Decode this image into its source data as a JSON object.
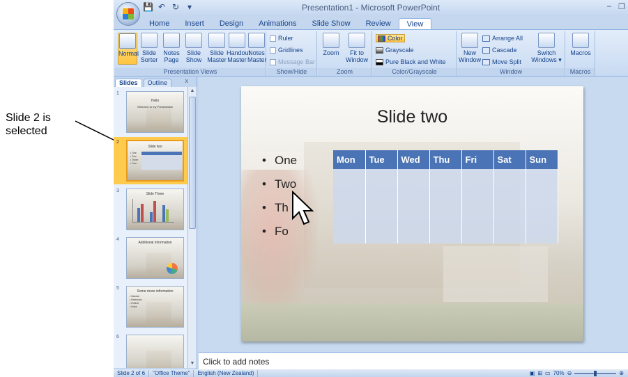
{
  "annotation": {
    "line1": "Slide 2 is",
    "line2": "selected"
  },
  "window": {
    "title": "Presentation1 - Microsoft PowerPoint",
    "minimize": "–",
    "restore": "❐"
  },
  "qat": {
    "save": "💾",
    "undo": "↶",
    "redo": "↻",
    "more": "▾"
  },
  "tabs": [
    {
      "label": "Home"
    },
    {
      "label": "Insert"
    },
    {
      "label": "Design"
    },
    {
      "label": "Animations"
    },
    {
      "label": "Slide Show"
    },
    {
      "label": "Review"
    },
    {
      "label": "View"
    }
  ],
  "ribbon": {
    "presentation_views": {
      "label": "Presentation Views",
      "normal": "Normal",
      "slide_sorter_1": "Slide",
      "slide_sorter_2": "Sorter",
      "notes_page_1": "Notes",
      "notes_page_2": "Page",
      "slide_show_1": "Slide",
      "slide_show_2": "Show",
      "slide_master_1": "Slide",
      "slide_master_2": "Master",
      "handout_master_1": "Handout",
      "handout_master_2": "Master",
      "notes_master_1": "Notes",
      "notes_master_2": "Master"
    },
    "show_hide": {
      "label": "Show/Hide",
      "ruler": "Ruler",
      "gridlines": "Gridlines",
      "message_bar": "Message Bar"
    },
    "zoom": {
      "label": "Zoom",
      "zoom": "Zoom",
      "fit_1": "Fit to",
      "fit_2": "Window"
    },
    "color": {
      "label": "Color/Grayscale",
      "color": "Color",
      "grayscale": "Grayscale",
      "pure_bw": "Pure Black and White"
    },
    "window": {
      "label": "Window",
      "new_1": "New",
      "new_2": "Window",
      "arrange_all": "Arrange All",
      "cascade": "Cascade",
      "move_split": "Move Split",
      "switch_1": "Switch",
      "switch_2": "Windows ▾"
    },
    "macros": {
      "label": "Macros",
      "macros": "Macros"
    }
  },
  "pane": {
    "tab_slides": "Slides",
    "tab_outline": "Outline",
    "close": "x",
    "slides": [
      {
        "num": "1",
        "title": "Hello",
        "subtitle": "Welcome to my Presentation"
      },
      {
        "num": "2",
        "title": "Slide two"
      },
      {
        "num": "3",
        "title": "Slide Three"
      },
      {
        "num": "4",
        "title": "Additional information"
      },
      {
        "num": "5",
        "title": "Some more information"
      },
      {
        "num": "6",
        "title": ""
      }
    ]
  },
  "slide": {
    "title": "Slide two",
    "bullets": [
      "One",
      "Two",
      "Th",
      "Fo"
    ],
    "days": [
      "Mon",
      "Tue",
      "Wed",
      "Thu",
      "Fri",
      "Sat",
      "Sun"
    ]
  },
  "notes": {
    "placeholder": "Click to add notes"
  },
  "status": {
    "slide": "Slide 2 of 6",
    "theme": "\"Office Theme\"",
    "language": "English (New Zealand)",
    "zoom": "70%"
  },
  "thumb2_bullets": [
    "• One",
    "• Two",
    "• Three",
    "• Four"
  ],
  "thumb5_bullets": [
    "• Natural",
    "• Extension",
    "• Further",
    "• Dolor"
  ]
}
